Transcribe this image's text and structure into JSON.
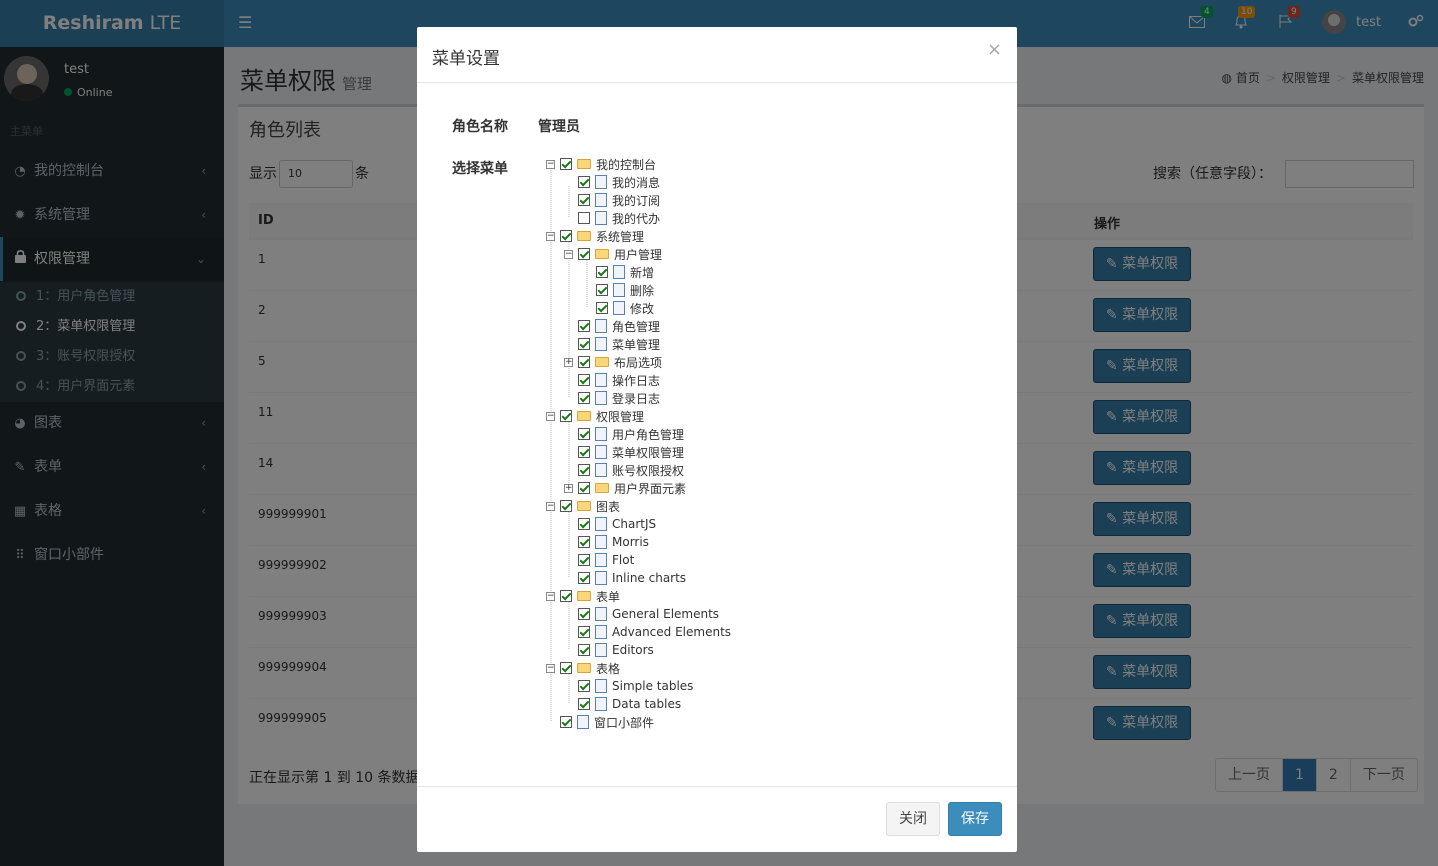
{
  "header": {
    "logo_bold": "Reshiram",
    "logo_light": " LTE",
    "toggle_icon": "☰",
    "notifications": [
      {
        "icon": "envelope-icon",
        "count": "4",
        "color": "#00a65a"
      },
      {
        "icon": "bell-icon",
        "count": "10",
        "color": "#f39c12"
      },
      {
        "icon": "flag-icon",
        "count": "9",
        "color": "#dd4b39"
      }
    ],
    "username": "test"
  },
  "sidebar": {
    "user_name": "test",
    "status": "Online",
    "section": "主菜单",
    "items": [
      {
        "label": "我的控制台",
        "icon": "dashboard-icon"
      },
      {
        "label": "系统管理",
        "icon": "gear-icon"
      },
      {
        "label": "权限管理",
        "icon": "lock-icon"
      },
      {
        "label": "图表",
        "icon": "pie-chart-icon"
      },
      {
        "label": "表单",
        "icon": "edit-icon"
      },
      {
        "label": "表格",
        "icon": "table-icon"
      },
      {
        "label": "窗口小部件",
        "icon": "grid-icon"
      }
    ],
    "subitems": [
      {
        "label": "1：用户角色管理"
      },
      {
        "label": "2：菜单权限管理"
      },
      {
        "label": "3：账号权限授权"
      },
      {
        "label": "4：用户界面元素"
      }
    ]
  },
  "content": {
    "title": "菜单权限",
    "subtitle": "管理",
    "breadcrumb": [
      "首页",
      "权限管理",
      "菜单权限管理"
    ],
    "box_title": "角色列表",
    "length_prefix": "显示",
    "length_value": "10",
    "length_suffix": "条",
    "search_label": "搜索（任意字段）：",
    "col_id": "ID",
    "col_action": "操作",
    "rows": [
      "1",
      "2",
      "5",
      "11",
      "14",
      "999999901",
      "999999902",
      "999999903",
      "999999904",
      "999999905"
    ],
    "action_label": "菜单权限",
    "info": "正在显示第 1 到 10 条数据",
    "pager": [
      "上一页",
      "1",
      "2",
      "下一页"
    ]
  },
  "modal": {
    "title": "菜单设置",
    "close_x": "×",
    "role_label": "角色名称",
    "role_value": "管理员",
    "menu_label": "选择菜单",
    "close_button": "关闭",
    "save_button": "保存",
    "tree": [
      {
        "label": "我的控制台",
        "level": 0,
        "folder": true,
        "checked": true,
        "sw": "−"
      },
      {
        "label": "我的消息",
        "level": 1,
        "folder": false,
        "checked": true
      },
      {
        "label": "我的订阅",
        "level": 1,
        "folder": false,
        "checked": true
      },
      {
        "label": "我的代办",
        "level": 1,
        "folder": false,
        "checked": false
      },
      {
        "label": "系统管理",
        "level": 0,
        "folder": true,
        "checked": true,
        "sw": "−"
      },
      {
        "label": "用户管理",
        "level": 1,
        "folder": true,
        "checked": true,
        "sw": "−"
      },
      {
        "label": "新增",
        "level": 2,
        "folder": false,
        "checked": true
      },
      {
        "label": "删除",
        "level": 2,
        "folder": false,
        "checked": true
      },
      {
        "label": "修改",
        "level": 2,
        "folder": false,
        "checked": true
      },
      {
        "label": "角色管理",
        "level": 1,
        "folder": false,
        "checked": true
      },
      {
        "label": "菜单管理",
        "level": 1,
        "folder": false,
        "checked": true
      },
      {
        "label": "布局选项",
        "level": 1,
        "folder": true,
        "checked": true,
        "sw": "+"
      },
      {
        "label": "操作日志",
        "level": 1,
        "folder": false,
        "checked": true
      },
      {
        "label": "登录日志",
        "level": 1,
        "folder": false,
        "checked": true
      },
      {
        "label": "权限管理",
        "level": 0,
        "folder": true,
        "checked": true,
        "sw": "−"
      },
      {
        "label": "用户角色管理",
        "level": 1,
        "folder": false,
        "checked": true
      },
      {
        "label": "菜单权限管理",
        "level": 1,
        "folder": false,
        "checked": true
      },
      {
        "label": "账号权限授权",
        "level": 1,
        "folder": false,
        "checked": true
      },
      {
        "label": "用户界面元素",
        "level": 1,
        "folder": true,
        "checked": true,
        "sw": "+"
      },
      {
        "label": "图表",
        "level": 0,
        "folder": true,
        "checked": true,
        "sw": "−"
      },
      {
        "label": "ChartJS",
        "level": 1,
        "folder": false,
        "checked": true
      },
      {
        "label": "Morris",
        "level": 1,
        "folder": false,
        "checked": true
      },
      {
        "label": "Flot",
        "level": 1,
        "folder": false,
        "checked": true
      },
      {
        "label": "Inline charts",
        "level": 1,
        "folder": false,
        "checked": true
      },
      {
        "label": "表单",
        "level": 0,
        "folder": true,
        "checked": true,
        "sw": "−"
      },
      {
        "label": "General Elements",
        "level": 1,
        "folder": false,
        "checked": true
      },
      {
        "label": "Advanced Elements",
        "level": 1,
        "folder": false,
        "checked": true
      },
      {
        "label": "Editors",
        "level": 1,
        "folder": false,
        "checked": true
      },
      {
        "label": "表格",
        "level": 0,
        "folder": true,
        "checked": true,
        "sw": "−"
      },
      {
        "label": "Simple tables",
        "level": 1,
        "folder": false,
        "checked": true
      },
      {
        "label": "Data tables",
        "level": 1,
        "folder": false,
        "checked": true
      },
      {
        "label": "窗口小部件",
        "level": 0,
        "folder": false,
        "checked": true
      }
    ]
  }
}
